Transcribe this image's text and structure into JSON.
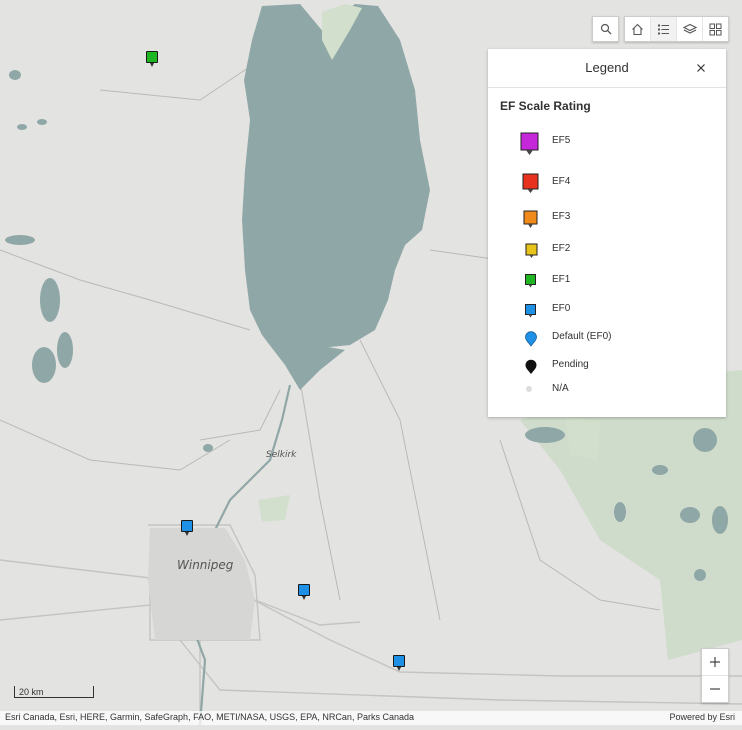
{
  "map": {
    "place_labels": [
      {
        "name": "Selkirk",
        "size": "small"
      },
      {
        "name": "Winnipeg",
        "size": "large"
      }
    ],
    "markers": [
      {
        "rating": "EF1",
        "color": "#1fb523"
      },
      {
        "rating": "EF0",
        "color": "#1e90e6"
      },
      {
        "rating": "EF0",
        "color": "#1e90e6"
      },
      {
        "rating": "EF0",
        "color": "#1e90e6"
      }
    ],
    "scale_label": "20 km"
  },
  "toolbar": {
    "icons": [
      "search-icon",
      "home-icon",
      "legend-list-icon",
      "layers-icon",
      "basemap-gallery-icon"
    ]
  },
  "legend": {
    "title": "Legend",
    "close_icon": "close-icon",
    "subtitle": "EF Scale Rating",
    "items": [
      {
        "label": "EF5",
        "color": "#c428d8",
        "shape": "square-pin"
      },
      {
        "label": "EF4",
        "color": "#e8321f",
        "shape": "square-pin"
      },
      {
        "label": "EF3",
        "color": "#f08a1a",
        "shape": "square-pin"
      },
      {
        "label": "EF2",
        "color": "#e8c31a",
        "shape": "square-pin"
      },
      {
        "label": "EF1",
        "color": "#1fb523",
        "shape": "square-pin"
      },
      {
        "label": "EF0",
        "color": "#1e90e6",
        "shape": "square-pin"
      },
      {
        "label": "Default (EF0)",
        "color": "#1e90e6",
        "shape": "round-pin"
      },
      {
        "label": "Pending",
        "color": "#111111",
        "shape": "round-pin"
      },
      {
        "label": "N/A",
        "color": "#dddddd",
        "shape": "dot"
      }
    ]
  },
  "zoom": {
    "in_label": "+",
    "out_label": "−"
  },
  "attribution": {
    "sources": "Esri Canada, Esri, HERE, Garmin, SafeGraph, FAO, METI/NASA, USGS, EPA, NRCan, Parks Canada",
    "powered_by": "Powered by Esri"
  },
  "colors": {
    "land": "#e3e3e1",
    "water": "#8fa7a6",
    "park": "#cfdccb",
    "roads": "#c4c4c2"
  }
}
